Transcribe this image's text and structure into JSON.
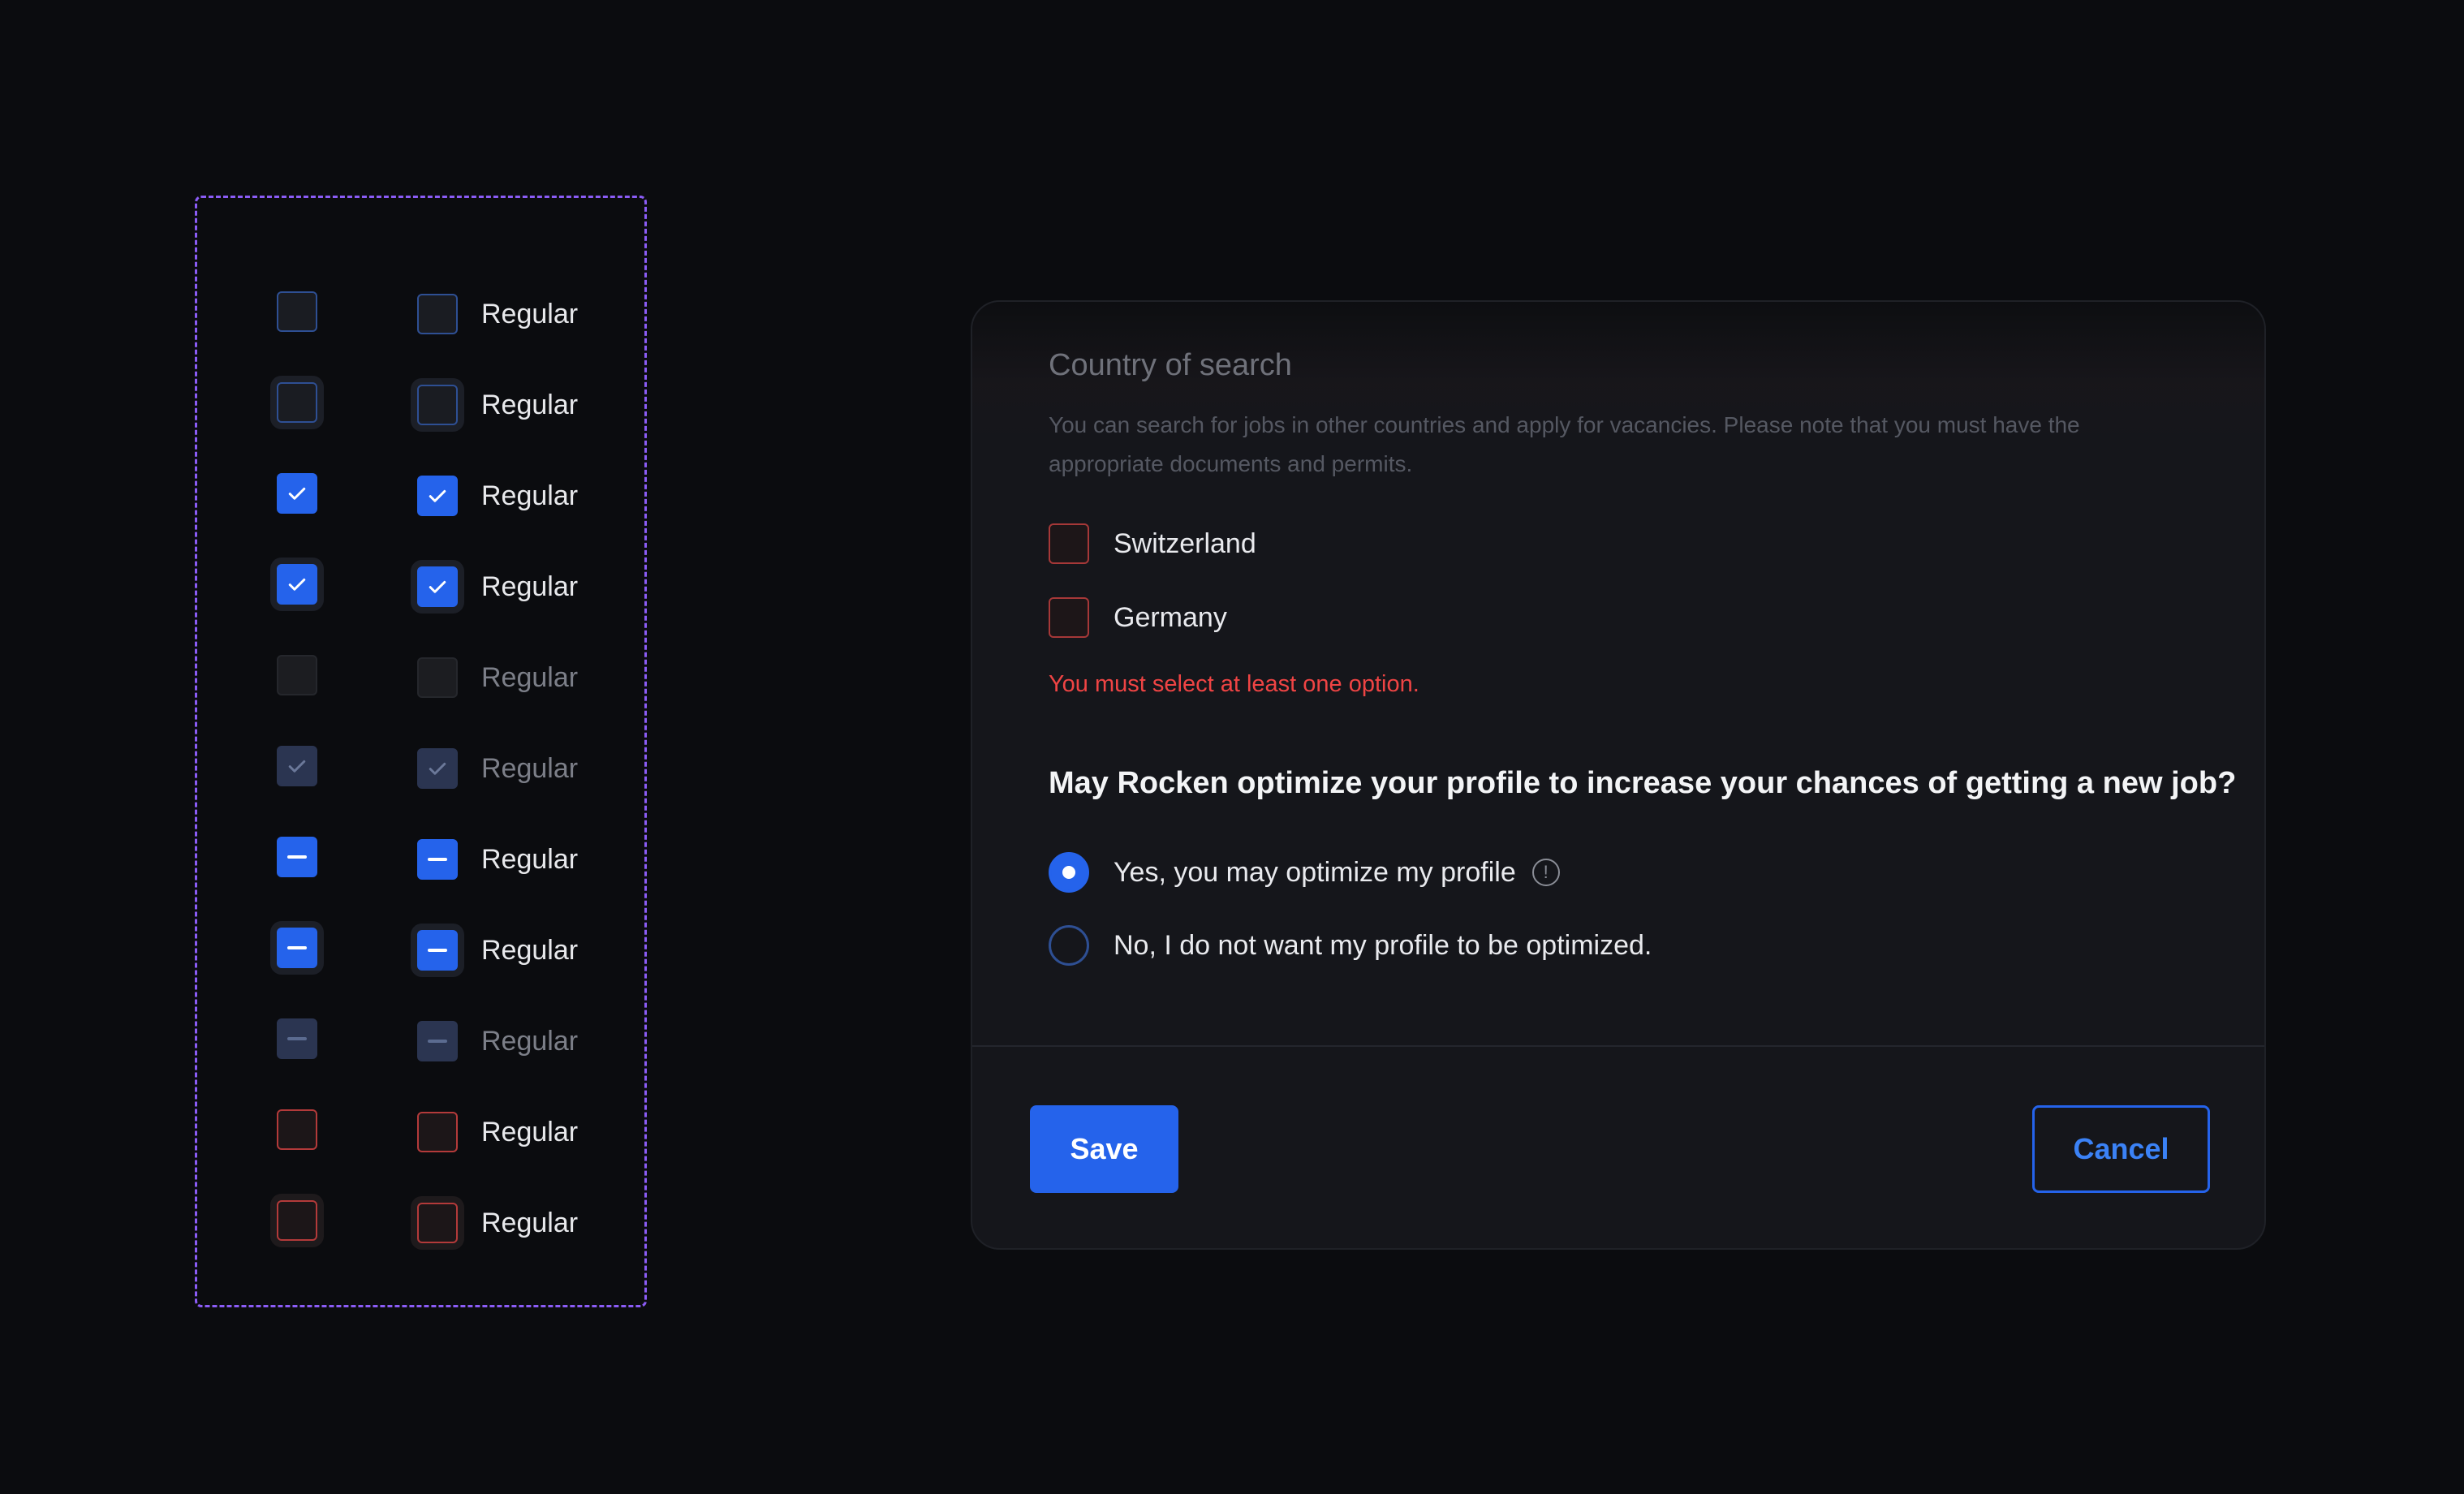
{
  "specimen": {
    "rows": [
      {
        "state": "default",
        "label": "Regular"
      },
      {
        "state": "focus",
        "label": "Regular"
      },
      {
        "state": "checked",
        "label": "Regular"
      },
      {
        "state": "checked-focus",
        "label": "Regular"
      },
      {
        "state": "disabled",
        "label": "Regular"
      },
      {
        "state": "disabled-checked",
        "label": "Regular"
      },
      {
        "state": "indeterminate",
        "label": "Regular"
      },
      {
        "state": "indeterminate-focus",
        "label": "Regular"
      },
      {
        "state": "disabled-indeterminate",
        "label": "Regular"
      },
      {
        "state": "error",
        "label": "Regular"
      },
      {
        "state": "error-focus",
        "label": "Regular"
      }
    ]
  },
  "form": {
    "section_title": "Country of search",
    "section_description": "You can search for jobs in other countries and apply for vacancies. Please note that you must have the appropriate documents and permits.",
    "countries": [
      {
        "label": "Switzerland",
        "checked": false
      },
      {
        "label": "Germany",
        "checked": false
      }
    ],
    "error_message": "You must select at least one option.",
    "question": "May Rocken optimize your profile to increase your chances of getting a new job?",
    "radio_options": [
      {
        "label": "Yes, you may optimize my profile",
        "selected": true,
        "info_icon": "info-icon"
      },
      {
        "label": "No, I do not want my profile to be optimized.",
        "selected": false
      }
    ],
    "save_label": "Save",
    "cancel_label": "Cancel"
  },
  "colors": {
    "accent": "#2563eb",
    "error": "#ef4444",
    "specimen_border": "#8b5cf6",
    "background": "#0b0c0f"
  }
}
